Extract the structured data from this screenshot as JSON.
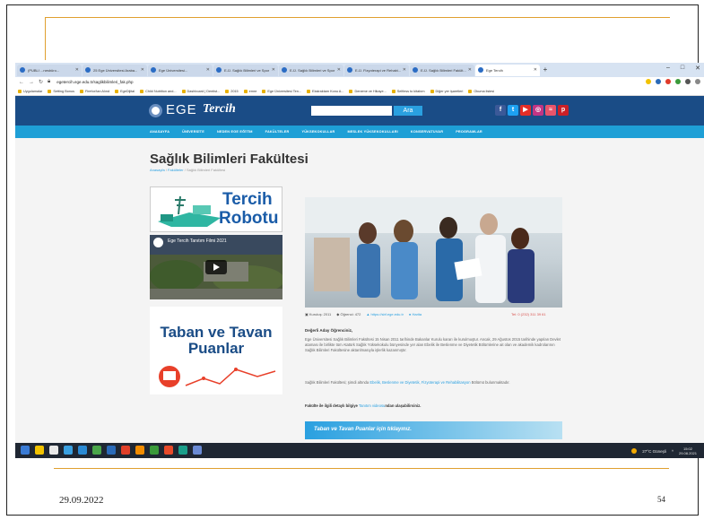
{
  "slide": {
    "date": "29.09.2022",
    "page_number": "54"
  },
  "browser": {
    "tabs": [
      {
        "label": "(PUBLI ...nesbüro...",
        "active": false
      },
      {
        "label": "25 Ege Üniversitesi Araba...",
        "active": false
      },
      {
        "label": "Ege Üniversitesi...",
        "active": false
      },
      {
        "label": "E-Ü. Sağlık Bilimleri ve Spor F...",
        "active": false
      },
      {
        "label": "E-Ü. Sağlık Bilimleri ve Spor F...",
        "active": false
      },
      {
        "label": "E-Ü. Fizyoterapi ve Rehabi...",
        "active": false
      },
      {
        "label": "E-Ü. Sağlık Bilimleri Fakült...",
        "active": false
      },
      {
        "label": "Ege Tercih",
        "active": true
      }
    ],
    "url": "egetercih.ege.edu.tr/saglikbilimleri_fak.php",
    "bookmarks": [
      "Uygulamalar",
      "Setting Bonus",
      "Firefox'tan Alınd",
      "EgeDijital",
      "Child Nutrition and...",
      "Dashboard | Dentist...",
      "2015",
      "emre",
      "Ege Üniversitesi Ten...",
      "Ekstraktam Konu A...",
      "Deneme ve Hikaye...",
      "Selfiess to kitabım",
      "Diğer yer işaretleri",
      "Okuma listesi"
    ],
    "window_controls": [
      "–",
      "□",
      "✕"
    ]
  },
  "site": {
    "logo_ege": "EGE",
    "logo_tercih": "Tercih",
    "search_button": "Ara",
    "social": [
      {
        "icon": "facebook-icon",
        "glyph": "f",
        "color": "#3b5998"
      },
      {
        "icon": "twitter-icon",
        "glyph": "t",
        "color": "#1da1f2"
      },
      {
        "icon": "youtube-icon",
        "glyph": "▶",
        "color": "#e52d27"
      },
      {
        "icon": "instagram-icon",
        "glyph": "◎",
        "color": "#c13584"
      },
      {
        "icon": "rss-icon",
        "glyph": "≈",
        "color": "#e8546a"
      },
      {
        "icon": "pinterest-icon",
        "glyph": "p",
        "color": "#cb2027"
      }
    ],
    "nav": [
      "ANASAYFA",
      "ÜNİVERSİTE",
      "NEDEN EGE EĞİTİM",
      "FAKÜLTELER",
      "YÜKSEKOKULLAR",
      "MESLEK YÜKSEKOKULLARI",
      "KONSERVATUVAR",
      "PROGRAMLAR"
    ]
  },
  "page": {
    "title": "Sağlık Bilimleri Fakültesi",
    "breadcrumb": {
      "home": "Anasayfa",
      "section": "Fakülteler",
      "current": "Sağlık Bilimleri Fakültesi"
    }
  },
  "sidebar": {
    "robot_line1": "Tercih",
    "robot_line2": "Robotu",
    "video_title": "Ege Tercih Tanıtım Filmi 2021",
    "taban_line1": "Taban ve Tavan",
    "taban_line2": "Puanlar"
  },
  "content": {
    "meta": {
      "founded": "Kuruluş: 2011",
      "students": "Öğrenci: 472",
      "web": "https://sbf.ege.edu.tr",
      "map": "Harita",
      "tel": "Tel: 0 (232) 311 39 61"
    },
    "greeting": "Değerli Aday Öğrenciniz,",
    "paragraph1": "Ege Üniversitesi Sağlık Bilimleri Fakültesi 15 Nisan 2011 tarihinde Bakanlar Kurulu kararı ile kurulmuştur. Ancak, 29 Ağustos 2015 tarihinde yapılan Devlet ataması ile birlikte tüm Atatürk Sağlık Yüksekokulu bünyesinde yer alan Ebelik ile Beslenme ve Diyetetik Bölümlerine ait olan ve akademik kadrolarının Sağlık Bilimleri Fakültesine aktarılmasıyla işlerlik kazanmıştır.",
    "paragraph2_lead": "Sağlık Bilimleri Fakültesi; şimdi altında ",
    "paragraph2_links": "Ebelik, Beslenme ve Diyetetik, Fizyoterapi ve Rehabilitasyon",
    "paragraph2_tail": " Bölümü bulunmaktadır.",
    "paragraph3_lead": "Fakülte ile ilgili detaylı bilgiye ",
    "paragraph3_link": "Tanıtım videosu",
    "paragraph3_tail": "ndan ulaşabilirsiniz.",
    "banner": "Taban ve Tavan Puanlar için tıklayınız."
  },
  "taskbar": {
    "icons": [
      "#3a7bd5",
      "#f2c200",
      "#e8e8e8",
      "#3aa0e0",
      "#2a8ad4",
      "#4aa64a",
      "#2a6ab8",
      "#e0402a",
      "#f28c00",
      "#3a9a3a",
      "#e84a2a",
      "#1a9e8a",
      "#6a8ad4"
    ],
    "weather": "27°C Güneşli",
    "time": "15:02",
    "date": "29.08.2021"
  },
  "colors": {
    "header": "#1a4c86",
    "nav": "#1e9fd6",
    "accent": "#2aa0e0",
    "slide_line": "#e0a030"
  }
}
